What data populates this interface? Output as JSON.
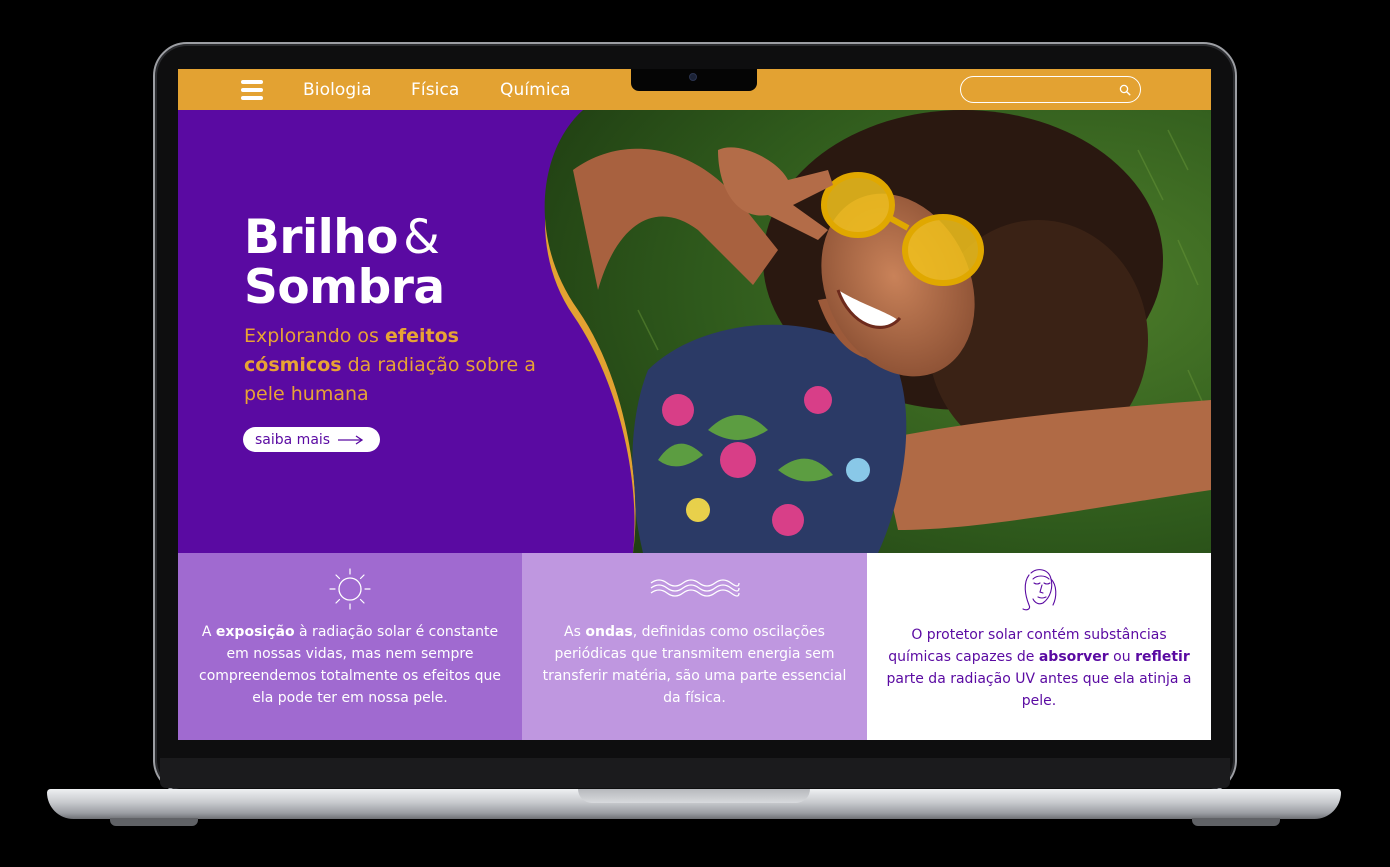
{
  "nav": {
    "links": [
      "Biologia",
      "Física",
      "Química"
    ],
    "search_placeholder": "",
    "icons": {
      "menu": "hamburger-menu-icon",
      "search": "search-icon"
    }
  },
  "hero": {
    "title_line1": "Brilho",
    "title_amp": "&",
    "title_line2": "Sombra",
    "subtitle_parts": [
      "Explorando os ",
      "efeitos cósmicos",
      " da radiação sobre a pele humana"
    ],
    "cta_label": "saiba mais",
    "cta_icon": "arrow-right-icon",
    "image": "smiling woman with yellow sunglasses lying on grass"
  },
  "cards": [
    {
      "icon": "sun-icon",
      "parts": [
        "A ",
        "exposição",
        " à radiação solar é constante em nossas vidas, mas nem sempre compreendemos totalmente os efeitos que ela pode ter em nossa pele."
      ]
    },
    {
      "icon": "waves-icon",
      "parts": [
        "As ",
        "ondas",
        ", definidas como oscilações periódicas que transmitem energia sem transferir matéria, são uma parte essencial da física."
      ]
    },
    {
      "icon": "face-icon",
      "parts": [
        "O protetor solar contém substâncias químicas capazes de ",
        "absorver",
        " ou ",
        "refletir",
        " parte da radiação UV antes que ela atinja a pele."
      ]
    }
  ],
  "colors": {
    "accent_orange": "#e3a232",
    "brand_purple": "#5a0aa2",
    "card1": "#a06ad0",
    "card2": "#bf97e0",
    "card3": "#ffffff"
  }
}
